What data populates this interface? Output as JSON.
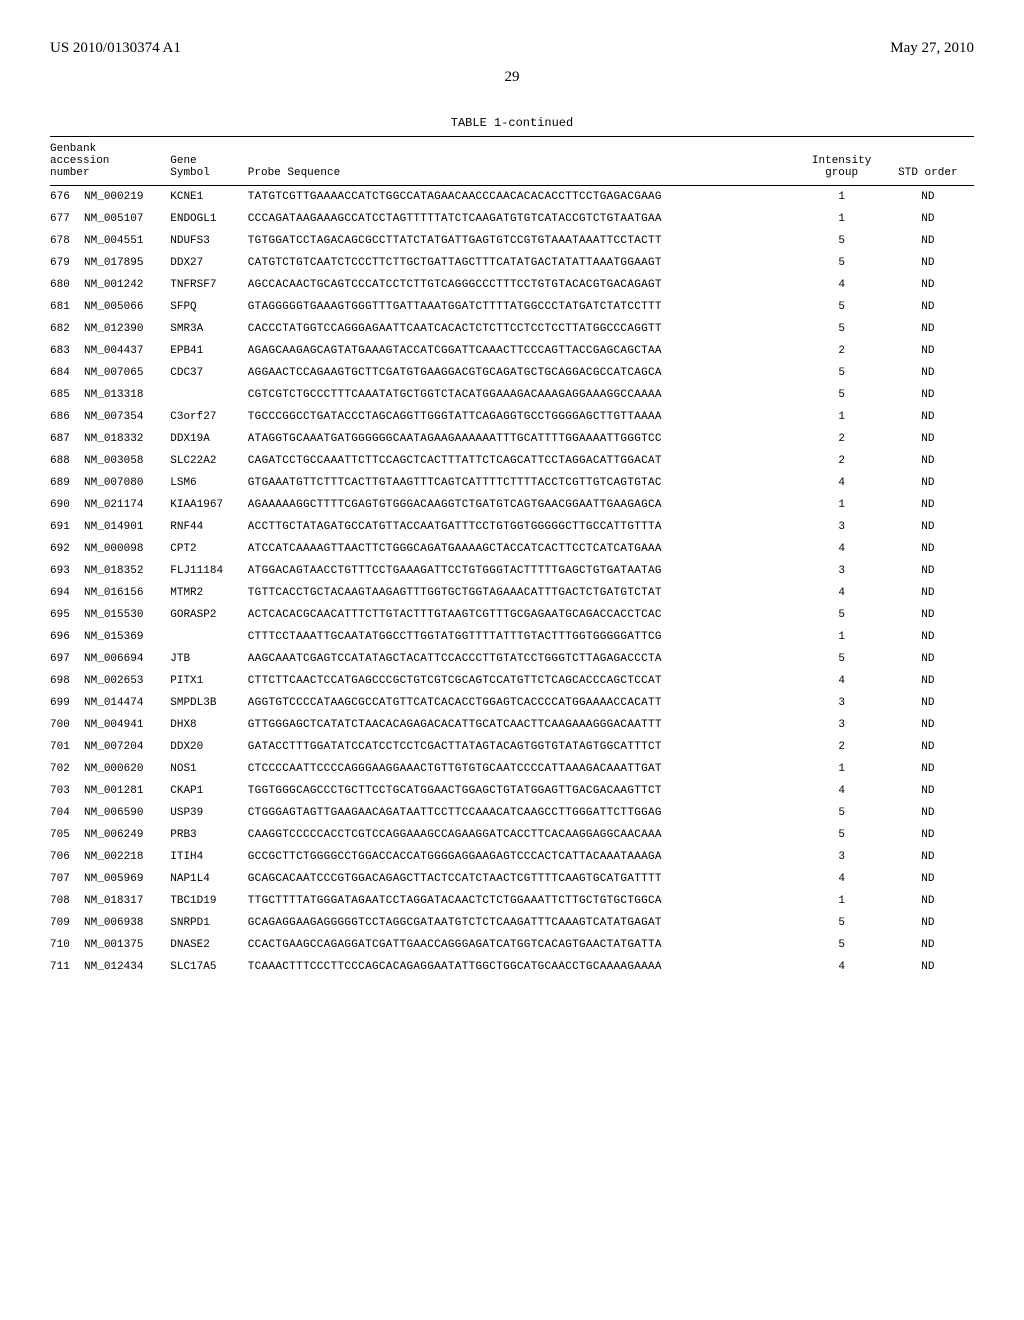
{
  "header": {
    "left": "US 2010/0130374 A1",
    "right": "May 27, 2010"
  },
  "page_number": "29",
  "table_title": "TABLE 1-continued",
  "columns": {
    "col1": "Genbank\naccession\nnumber",
    "col2": "Gene\nSymbol",
    "col3": "Probe Sequence",
    "col4": "Intensity\ngroup",
    "col5": "STD order"
  },
  "rows": [
    {
      "n": "676",
      "acc": "NM_000219",
      "gene": "KCNE1",
      "seq": "TATGTCGTTGAAAACCATCTGGCCATAGAACAACCCAACACACACCTTCCTGAGACGAAG",
      "grp": "1",
      "std": "ND"
    },
    {
      "n": "677",
      "acc": "NM_005107",
      "gene": "ENDOGL1",
      "seq": "CCCAGATAAGAAAGCCATCCTAGTTTTTATCTCAAGATGTGTCATACCGTCTGTAATGAA",
      "grp": "1",
      "std": "ND"
    },
    {
      "n": "678",
      "acc": "NM_004551",
      "gene": "NDUFS3",
      "seq": "TGTGGATCCTAGACAGCGCCTTATCTATGATTGAGTGTCCGTGTAAATAAATTCCTACTT",
      "grp": "5",
      "std": "ND"
    },
    {
      "n": "679",
      "acc": "NM_017895",
      "gene": "DDX27",
      "seq": "CATGTCTGTCAATCTCCCTTCTTGCTGATTAGCTTTCATATGACTATATTAAATGGAAGT",
      "grp": "5",
      "std": "ND"
    },
    {
      "n": "680",
      "acc": "NM_001242",
      "gene": "TNFRSF7",
      "seq": "AGCCACAACTGCAGTCCCATCCTCTTGTCAGGGCCCTTTCCTGTGTACACGTGACAGAGT",
      "grp": "4",
      "std": "ND"
    },
    {
      "n": "681",
      "acc": "NM_005066",
      "gene": "SFPQ",
      "seq": "GTAGGGGGTGAAAGTGGGTTTGATTAAATGGATCTTTTATGGCCCTATGATCTATCCTTT",
      "grp": "5",
      "std": "ND"
    },
    {
      "n": "682",
      "acc": "NM_012390",
      "gene": "SMR3A",
      "seq": "CACCCTATGGTCCAGGGAGAATTCAATCACACTCTCTTCCTCCTCCTTATGGCCCAGGTT",
      "grp": "5",
      "std": "ND"
    },
    {
      "n": "683",
      "acc": "NM_004437",
      "gene": "EPB41",
      "seq": "AGAGCAAGAGCAGTATGAAAGTACCATCGGATTCAAACTTCCCAGTTACCGAGCAGCTAA",
      "grp": "2",
      "std": "ND"
    },
    {
      "n": "684",
      "acc": "NM_007065",
      "gene": "CDC37",
      "seq": "AGGAACTCCAGAAGTGCTTCGATGTGAAGGACGTGCAGATGCTGCAGGACGCCATCAGCA",
      "grp": "5",
      "std": "ND"
    },
    {
      "n": "685",
      "acc": "NM_013318",
      "gene": "",
      "seq": "CGTCGTCTGCCCTTTCAAATATGCTGGTCTACATGGAAAGACAAAGAGGAAAGGCCAAAA",
      "grp": "5",
      "std": "ND"
    },
    {
      "n": "686",
      "acc": "NM_007354",
      "gene": "C3orf27",
      "seq": "TGCCCGGCCTGATACCCTAGCAGGTTGGGTATTCAGAGGTGCCTGGGGAGCTTGTTAAAA",
      "grp": "1",
      "std": "ND"
    },
    {
      "n": "687",
      "acc": "NM_018332",
      "gene": "DDX19A",
      "seq": "ATAGGTGCAAATGATGGGGGGCAATAGAAGAAAAAATTTGCATTTTGGAAAATTGGGTCC",
      "grp": "2",
      "std": "ND"
    },
    {
      "n": "688",
      "acc": "NM_003058",
      "gene": "SLC22A2",
      "seq": "CAGATCCTGCCAAATTCTTCCAGCTCACTTTATTCTCAGCATTCCTAGGACATTGGACAT",
      "grp": "2",
      "std": "ND"
    },
    {
      "n": "689",
      "acc": "NM_007080",
      "gene": "LSM6",
      "seq": "GTGAAATGTTCTTTCACTTGTAAGTTTCAGTCATTTTCTTTTACCTCGTTGTCAGTGTAC",
      "grp": "4",
      "std": "ND"
    },
    {
      "n": "690",
      "acc": "NM_021174",
      "gene": "KIAA1967",
      "seq": "AGAAAAAGGCTTTTCGAGTGTGGGACAAGGTCTGATGTCAGTGAACGGAATTGAAGAGCA",
      "grp": "1",
      "std": "ND"
    },
    {
      "n": "691",
      "acc": "NM_014901",
      "gene": "RNF44",
      "seq": "ACCTTGCTATAGATGCCATGTTACCAATGATTTCCTGTGGTGGGGGCTTGCCATTGTTTA",
      "grp": "3",
      "std": "ND"
    },
    {
      "n": "692",
      "acc": "NM_000098",
      "gene": "CPT2",
      "seq": "ATCCATCAAAAGTTAACTTCTGGGCAGATGAAAAGCTACCATCACTTCCTCATCATGAAA",
      "grp": "4",
      "std": "ND"
    },
    {
      "n": "693",
      "acc": "NM_018352",
      "gene": "FLJ11184",
      "seq": "ATGGACAGTAACCTGTTTCCTGAAAGATTCCTGTGGGTACTTTTTGAGCTGTGATAATAG",
      "grp": "3",
      "std": "ND"
    },
    {
      "n": "694",
      "acc": "NM_016156",
      "gene": "MTMR2",
      "seq": "TGTTCACCTGCTACAAGTAAGAGTTTGGTGCTGGTAGAAACATTTGACTCTGATGTCTAT",
      "grp": "4",
      "std": "ND"
    },
    {
      "n": "695",
      "acc": "NM_015530",
      "gene": "GORASP2",
      "seq": "ACTCACACGCAACATTTCTTGTACTTTGTAAGTCGTTTGCGAGAATGCAGACCACCTCAC",
      "grp": "5",
      "std": "ND"
    },
    {
      "n": "696",
      "acc": "NM_015369",
      "gene": "",
      "seq": "CTTTCCTAAATTGCAATATGGCCTTGGTATGGTTTTATTTGTACTTTGGTGGGGGATTCG",
      "grp": "1",
      "std": "ND"
    },
    {
      "n": "697",
      "acc": "NM_006694",
      "gene": "JTB",
      "seq": "AAGCAAATCGAGTCCATATAGCTACATTCCACCCTTGTATCCTGGGTCTTAGAGACCCTA",
      "grp": "5",
      "std": "ND"
    },
    {
      "n": "698",
      "acc": "NM_002653",
      "gene": "PITX1",
      "seq": "CTTCTTCAACTCCATGAGCCCGCTGTCGTCGCAGTCCATGTTCTCAGCACCCAGCTCCAT",
      "grp": "4",
      "std": "ND"
    },
    {
      "n": "699",
      "acc": "NM_014474",
      "gene": "SMPDL3B",
      "seq": "AGGTGTCCCCATAAGCGCCATGTTCATCACACCTGGAGTCACCCCATGGAAAACCACATT",
      "grp": "3",
      "std": "ND"
    },
    {
      "n": "700",
      "acc": "NM_004941",
      "gene": "DHX8",
      "seq": "GTTGGGAGCTCATATCTAACACAGAGACACATTGCATCAACTTCAAGAAAGGGACAATTT",
      "grp": "3",
      "std": "ND"
    },
    {
      "n": "701",
      "acc": "NM_007204",
      "gene": "DDX20",
      "seq": "GATACCTTTGGATATCCATCCTCCTCGACTTATAGTACAGTGGTGTATAGTGGCATTTCT",
      "grp": "2",
      "std": "ND"
    },
    {
      "n": "702",
      "acc": "NM_000620",
      "gene": "NOS1",
      "seq": "CTCCCCAATTCCCCAGGGAAGGAAACTGTTGTGTGCAATCCCCATTAAAGACAAATTGAT",
      "grp": "1",
      "std": "ND"
    },
    {
      "n": "703",
      "acc": "NM_001281",
      "gene": "CKAP1",
      "seq": "TGGTGGGCAGCCCTGCTTCCTGCATGGAACTGGAGCTGTATGGAGTTGACGACAAGTTCT",
      "grp": "4",
      "std": "ND"
    },
    {
      "n": "704",
      "acc": "NM_006590",
      "gene": "USP39",
      "seq": "CTGGGAGTAGTTGAAGAACAGATAATTCCTTCCAAACATCAAGCCTTGGGATTCTTGGAG",
      "grp": "5",
      "std": "ND"
    },
    {
      "n": "705",
      "acc": "NM_006249",
      "gene": "PRB3",
      "seq": "CAAGGTCCCCCACCTCGTCCAGGAAAGCCAGAAGGATCACCTTCACAAGGAGGCAACAAA",
      "grp": "5",
      "std": "ND"
    },
    {
      "n": "706",
      "acc": "NM_002218",
      "gene": "ITIH4",
      "seq": "GCCGCTTCTGGGGCCTGGACCACCATGGGGAGGAAGAGTCCCACTCATTACAAATAAAGA",
      "grp": "3",
      "std": "ND"
    },
    {
      "n": "707",
      "acc": "NM_005969",
      "gene": "NAP1L4",
      "seq": "GCAGCACAATCCCGTGGACAGAGCTTACTCCATCTAACTCGTTTTCAAGTGCATGATTTT",
      "grp": "4",
      "std": "ND"
    },
    {
      "n": "708",
      "acc": "NM_018317",
      "gene": "TBC1D19",
      "seq": "TTGCTTTTATGGGATAGAATCCTAGGATACAACTCTCTGGAAATTCTTGCTGTGCTGGCA",
      "grp": "1",
      "std": "ND"
    },
    {
      "n": "709",
      "acc": "NM_006938",
      "gene": "SNRPD1",
      "seq": "GCAGAGGAAGAGGGGGTCCTAGGCGATAATGTCTCTCAAGATTTCAAAGTCATATGAGAT",
      "grp": "5",
      "std": "ND"
    },
    {
      "n": "710",
      "acc": "NM_001375",
      "gene": "DNASE2",
      "seq": "CCACTGAAGCCAGAGGATCGATTGAACCAGGGAGATCATGGTCACAGTGAACTATGATTA",
      "grp": "5",
      "std": "ND"
    },
    {
      "n": "711",
      "acc": "NM_012434",
      "gene": "SLC17A5",
      "seq": "TCAAACTTTCCCTTCCCAGCACAGAGGAATATTGGCTGGCATGCAACCTGCAAAAGAAAA",
      "grp": "4",
      "std": "ND"
    }
  ]
}
